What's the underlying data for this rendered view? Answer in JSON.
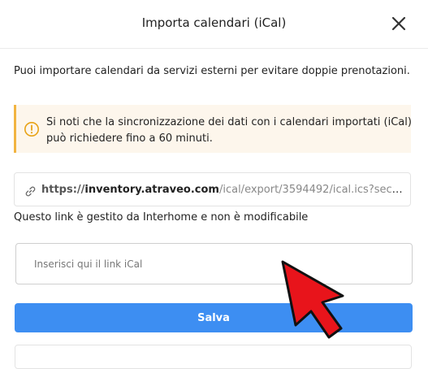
{
  "dialog": {
    "title": "Importa calendari (iCal)",
    "intro": "Puoi importare calendari da servizi esterni per evitare doppie prenotazioni.",
    "notice": {
      "icon": "warning-circle-icon",
      "text": "Si noti che la sincronizzazione dei dati con i calendari importati (iCal) può richiedere fino a 60 minuti."
    },
    "export_link": {
      "icon": "link-icon",
      "scheme": "https://",
      "domain": "inventory.atraveo.com",
      "path": "/ical/export/3594492/ical.ics?secu...",
      "note": "Questo link è gestito da Interhome e non è modificabile"
    },
    "ical_input": {
      "value": "",
      "placeholder": "Inserisci qui il link iCal"
    },
    "save_label": "Salva",
    "close_icon": "close-icon"
  },
  "colors": {
    "primary": "#3d8ef2",
    "warning_accent": "#f2b441",
    "warning_bg": "#fdf6ec",
    "cursor": "#e8141b"
  }
}
